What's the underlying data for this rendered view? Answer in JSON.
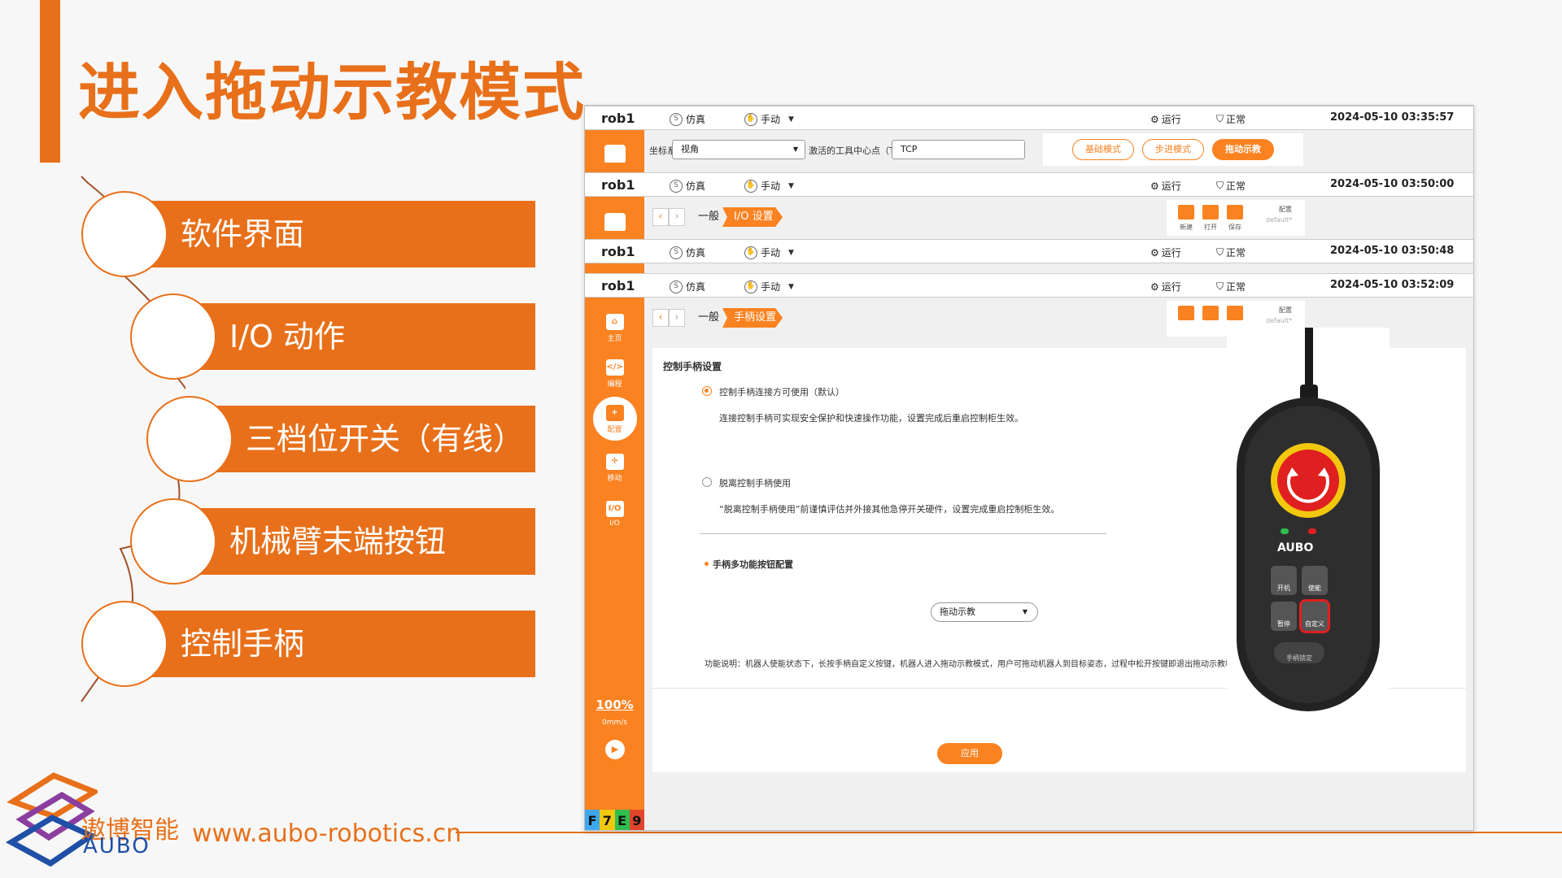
{
  "slide": {
    "title": "进入拖动示教模式",
    "menu": [
      "软件界面",
      "I/O 动作",
      "三档位开关（有线）",
      "机械臂末端按钮",
      "控制手柄"
    ],
    "brand_cn": "遨博智能",
    "brand_en": "AUBO",
    "url": "www.aubo-robotics.cn"
  },
  "colors": {
    "accent": "#e8701a",
    "ui_orange": "#fa8220",
    "brand_blue": "#1f4fa6"
  },
  "status": {
    "robot": "rob1",
    "sim": "仿真",
    "mode": "手动",
    "run": "运行",
    "normal": "正常",
    "times": [
      "2024-05-10 03:35:57",
      "2024-05-10 03:50:00",
      "2024-05-10 03:50:48",
      "2024-05-10 03:52:09"
    ]
  },
  "toolbar": {
    "coord_label": "坐标系",
    "coord_value": "视角",
    "tcp_label": "激活的工具中心点（TCP）",
    "tcp_value": "TCP",
    "modes": [
      "基础模式",
      "步进模式",
      "拖动示教"
    ]
  },
  "breadcrumb": {
    "general": "一般",
    "io": "I/O 设置",
    "handle": "手柄设置"
  },
  "config": {
    "new": "新建",
    "open": "打开",
    "save": "保存",
    "label": "配置",
    "value": "default*"
  },
  "nav": [
    {
      "icon": "⌂",
      "label": "主页"
    },
    {
      "icon": "</>",
      "label": "编程"
    },
    {
      "icon": "+",
      "label": "配置"
    },
    {
      "icon": "✛",
      "label": "移动"
    },
    {
      "icon": "I/O",
      "label": "I/O"
    }
  ],
  "speed": {
    "percent": "100%",
    "unit": "0mm/s"
  },
  "f_keys": [
    "F",
    "7",
    "E",
    "9"
  ],
  "handle": {
    "section_title": "控制手柄设置",
    "opt1": "控制手柄连接方可使用（默认）",
    "opt1_desc": "连接控制手柄可实现安全保护和快速操作功能，设置完成后重启控制柜生效。",
    "opt2": "脱离控制手柄使用",
    "opt2_desc": "“脱离控制手柄使用”前谨慎评估并外接其他急停开关硬件，设置完成重启控制柜生效。",
    "multi_title": "手柄多功能按钮配置",
    "select_value": "拖动示教",
    "func_desc": "功能说明：机器人使能状态下，长按手柄自定义按键，机器人进入拖动示教模式，用户可拖动机器人到目标姿态，过程中松开按键即退出拖动示教模式。",
    "apply": "应用"
  },
  "pendant": {
    "brand": "AUBO",
    "btn1": "开机",
    "btn2": "使能",
    "btn3": "暂停",
    "btn4": "自定义",
    "lock": "手柄锁定"
  }
}
